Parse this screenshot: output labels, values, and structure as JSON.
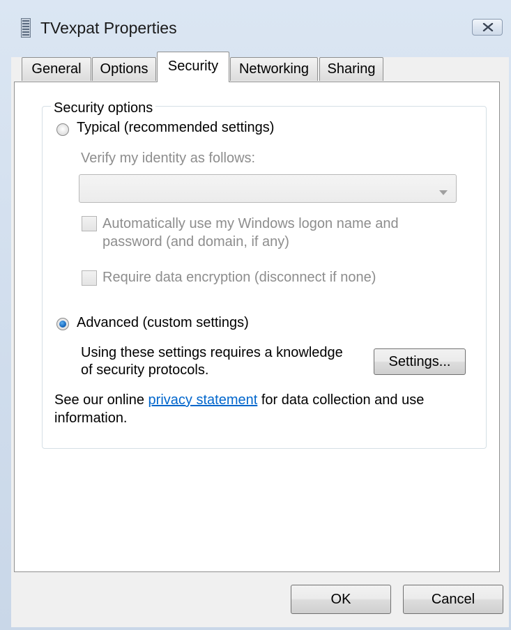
{
  "window": {
    "title": "TVexpat Properties"
  },
  "tabs": [
    {
      "label": "General",
      "active": false
    },
    {
      "label": "Options",
      "active": false
    },
    {
      "label": "Security",
      "active": true
    },
    {
      "label": "Networking",
      "active": false
    },
    {
      "label": "Sharing",
      "active": false
    }
  ],
  "security": {
    "group_title": "Security options",
    "typical": {
      "label": "Typical (recommended settings)",
      "selected": false,
      "verify_label": "Verify my identity as follows:",
      "verify_value": "",
      "auto_logon_line1": "Automatically use my Windows logon name and",
      "auto_logon_line2": "password (and domain, if any)",
      "auto_logon_checked": false,
      "require_encryption": "Require data encryption (disconnect if none)",
      "require_encryption_checked": false
    },
    "advanced": {
      "label": "Advanced (custom settings)",
      "selected": true,
      "desc_line1": "Using these settings requires a knowledge",
      "desc_line2": "of security protocols.",
      "settings_button": "Settings..."
    },
    "privacy": {
      "prefix": "See our online ",
      "link": "privacy statement",
      "suffix": " for data collection and use",
      "line2": "information."
    }
  },
  "footer": {
    "ok": "OK",
    "cancel": "Cancel"
  },
  "colors": {
    "link": "#0066cc",
    "radio_selected": "#1c6fc4",
    "disabled_text": "#8d8d8d"
  },
  "icons": {
    "title": "document-icon",
    "close": "close-icon",
    "combo": "chevron-down-icon"
  }
}
